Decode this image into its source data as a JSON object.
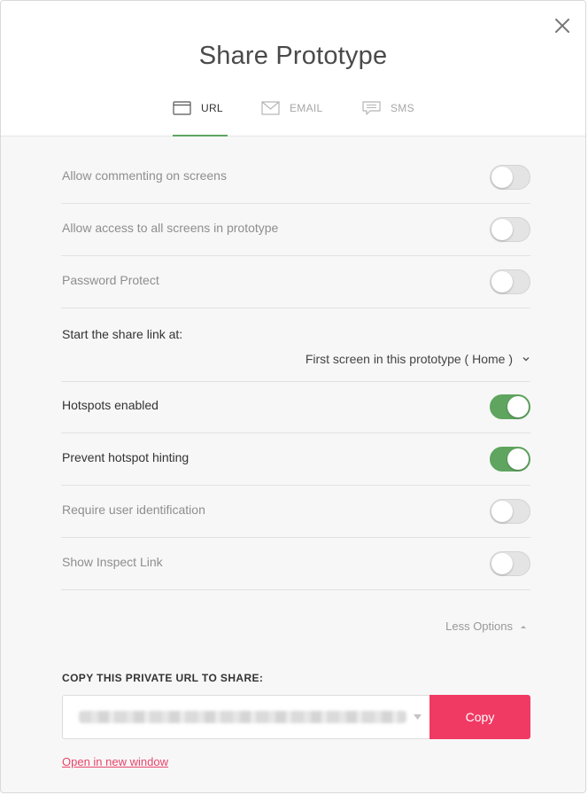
{
  "dialog": {
    "title": "Share Prototype",
    "close_icon": "close-icon"
  },
  "tabs": [
    {
      "label": "URL",
      "icon": "browser-window-icon",
      "active": true
    },
    {
      "label": "EMAIL",
      "icon": "envelope-icon",
      "active": false
    },
    {
      "label": "SMS",
      "icon": "chat-bubble-icon",
      "active": false
    }
  ],
  "settings": [
    {
      "label": "Allow commenting on screens",
      "enabled": false
    },
    {
      "label": "Allow access to all screens in prototype",
      "enabled": false
    },
    {
      "label": "Password Protect",
      "enabled": false
    },
    {
      "label": "Hotspots enabled",
      "enabled": true
    },
    {
      "label": "Prevent hotspot hinting",
      "enabled": true
    },
    {
      "label": "Require user identification",
      "enabled": false
    },
    {
      "label": "Show Inspect Link",
      "enabled": false
    }
  ],
  "start_link": {
    "label": "Start the share link at:",
    "selected": "First screen in this prototype ( Home )"
  },
  "options_toggle": "Less Options",
  "share": {
    "heading": "COPY THIS PRIVATE URL TO SHARE:",
    "copy_label": "Copy",
    "open_link": "Open in new window"
  },
  "colors": {
    "accent_green": "#5fa45f",
    "copy_button": "#f03a63",
    "link": "#e8456a"
  }
}
